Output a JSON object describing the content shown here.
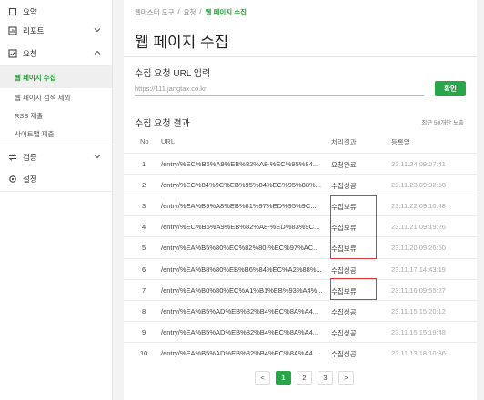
{
  "sidebar": {
    "items": [
      {
        "label": "요약",
        "icon": "home-icon"
      },
      {
        "label": "리포트",
        "icon": "report-icon"
      },
      {
        "label": "요청",
        "icon": "request-icon"
      },
      {
        "label": "검증",
        "icon": "verify-icon"
      },
      {
        "label": "설정",
        "icon": "gear-icon"
      }
    ],
    "subitems": [
      {
        "label": "웹 페이지 수집"
      },
      {
        "label": "웹 페이지 검색 제외"
      },
      {
        "label": "RSS 제출"
      },
      {
        "label": "사이트맵 제출"
      }
    ]
  },
  "breadcrumb": [
    "웹마스터 도구",
    "요청",
    "웹 페이지 수집"
  ],
  "page_title": "웹 페이지 수집",
  "form": {
    "label": "수집 요청 URL 입력",
    "placeholder": "https://111.jangtax.co.kr",
    "button": "확인"
  },
  "results": {
    "label": "수집 요청 결과",
    "note": "최근 50개만 노출",
    "columns": [
      "No",
      "URL",
      "처리결과",
      "등록일"
    ],
    "rows": [
      {
        "no": "1",
        "url": "/entry/%EC%B6%A9%EB%82%A8-%EC%95%84...",
        "status": "요청완료",
        "date": "23.11.24 09:07:41"
      },
      {
        "no": "2",
        "url": "/entry/%EC%84%9C%EB%95%84%EC%95%88%...",
        "status": "수집성공",
        "date": "23.11.23 09:32:50"
      },
      {
        "no": "3",
        "url": "/entry/%EA%B9%A8%EB%81%97%ED%95%9C...",
        "status": "수집보류",
        "date": "23.11.22 09:10:48"
      },
      {
        "no": "4",
        "url": "/entry/%EC%B6%A9%EB%82%A8-%ED%83%9C...",
        "status": "수집보류",
        "date": "23.11.21 09:19:26"
      },
      {
        "no": "5",
        "url": "/entry/%EA%B5%80%EC%82%80-%EC%97%AC...",
        "status": "수집보류",
        "date": "23.11.20 09:26:50"
      },
      {
        "no": "6",
        "url": "/entry/%EA%B8%80%EB%B6%84%EC%A2%88%...",
        "status": "수집성공",
        "date": "23.11.17 14:43:19"
      },
      {
        "no": "7",
        "url": "/entry/%EA%B0%80%EC%A1%B1%EB%93%A4%...",
        "status": "수집보류",
        "date": "23.11.16 09:55:27"
      },
      {
        "no": "8",
        "url": "/entry/%EA%B5%AD%EB%82%B4%EC%8A%A4...",
        "status": "수집성공",
        "date": "23.11.15 15:20:12"
      },
      {
        "no": "9",
        "url": "/entry/%EA%B5%AD%EB%82%B4%EC%8A%A4...",
        "status": "수집성공",
        "date": "23.11.15 15:19:48"
      },
      {
        "no": "10",
        "url": "/entry/%EA%B5%AD%EB%82%B4%EC%8A%A4...",
        "status": "수집성공",
        "date": "23.11.13 18:10:36"
      }
    ]
  },
  "pagination": {
    "prev": "<",
    "pages": [
      "1",
      "2",
      "3"
    ],
    "next": ">",
    "current": "1"
  },
  "colors": {
    "accent": "#2aa64a",
    "highlight": "#e0383a"
  }
}
